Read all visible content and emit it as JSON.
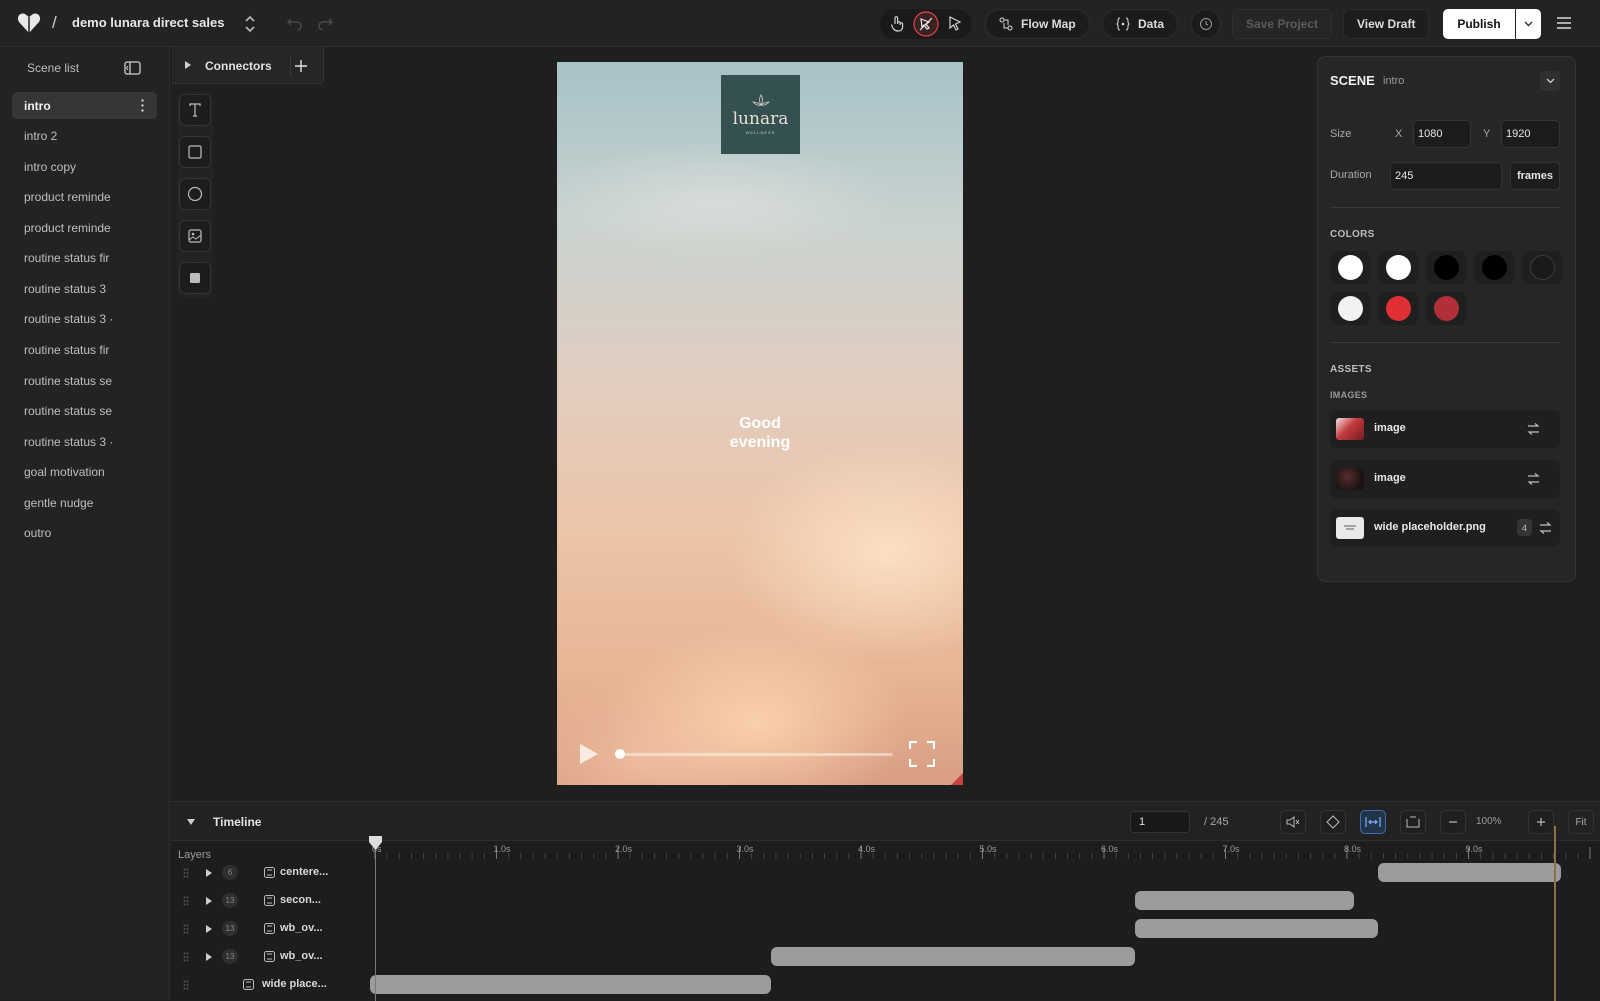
{
  "topbar": {
    "project_name": "demo lunara direct sales",
    "separator": "/",
    "flow_map_label": "Flow Map",
    "data_label": "Data",
    "save_label": "Save Project",
    "view_draft_label": "View Draft",
    "publish_label": "Publish"
  },
  "sidebar": {
    "title": "Scene list",
    "scenes": [
      "intro",
      "intro 2",
      "intro copy",
      "product reminde",
      "product reminde",
      "routine status fir",
      "routine status 3",
      "routine status 3 ·",
      "routine status fir",
      "routine status se",
      "routine status se",
      "routine status 3 ·",
      "goal motivation",
      "gentle nudge",
      "outro"
    ]
  },
  "connectors": {
    "label": "Connectors"
  },
  "preview": {
    "brand_name": "lunara",
    "brand_sub": "WELLNESS",
    "greeting_line1": "Good",
    "greeting_line2": "evening",
    "progress": 0.0
  },
  "panel": {
    "title": "SCENE",
    "subtitle": "intro",
    "size_label": "Size",
    "x_label": "X",
    "x_value": "1080",
    "y_label": "Y",
    "y_value": "1920",
    "duration_label": "Duration",
    "duration_value": "245",
    "frames_label": "frames",
    "colors_label": "COLORS",
    "colors": [
      "#ffffff",
      "#ffffff",
      "#000000",
      "#000000",
      "#1a1a1a",
      "#f2f2f2",
      "#e03036",
      "#b0303a"
    ],
    "assets_label": "ASSETS",
    "images_label": "IMAGES",
    "assets": [
      {
        "name": "image"
      },
      {
        "name": "image"
      },
      {
        "name": "wide placeholder.png",
        "count": "4"
      }
    ]
  },
  "timeline": {
    "title": "Timeline",
    "frame_value": "1",
    "frame_total": "/ 245",
    "zoom": "100%",
    "fit_label": "Fit",
    "layers_label": "Layers",
    "ticks": [
      "0s",
      "1.0s",
      "2.0s",
      "3.0s",
      "4.0s",
      "5.0s",
      "6.0s",
      "7.0s",
      "8.0s",
      "9.0s"
    ],
    "layers": [
      {
        "count": "6",
        "name": "centere...",
        "start": 8.3,
        "end": 9.8
      },
      {
        "count": "13",
        "name": "secon...",
        "start": 6.3,
        "end": 8.1
      },
      {
        "count": "13",
        "name": "wb_ov...",
        "start": 6.3,
        "end": 8.3
      },
      {
        "count": "13",
        "name": "wb_ov...",
        "start": 3.3,
        "end": 6.3
      },
      {
        "count": "",
        "name": "wide place...",
        "start": 0.0,
        "end": 3.3
      }
    ]
  },
  "colors": {
    "accent": "#3b6fb0",
    "record": "#e0454b"
  }
}
